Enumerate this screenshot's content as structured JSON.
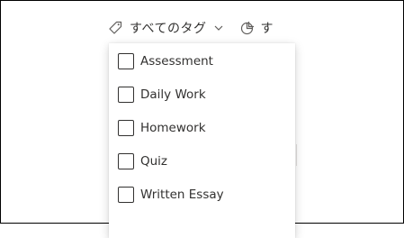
{
  "toolbar": {
    "tag_filter_label": "すべてのタグ",
    "next_filter_label": "す"
  },
  "dropdown": {
    "options": [
      {
        "label": "Assessment",
        "checked": false
      },
      {
        "label": "Daily Work",
        "checked": false
      },
      {
        "label": "Homework",
        "checked": false
      },
      {
        "label": "Quiz",
        "checked": false
      },
      {
        "label": "Written Essay",
        "checked": false
      }
    ]
  },
  "icons": {
    "tag": "tag-icon",
    "chevron": "chevron-down-icon",
    "chart": "pie-chart-icon"
  },
  "colors": {
    "text": "#323130",
    "muted": "#605e5c"
  }
}
